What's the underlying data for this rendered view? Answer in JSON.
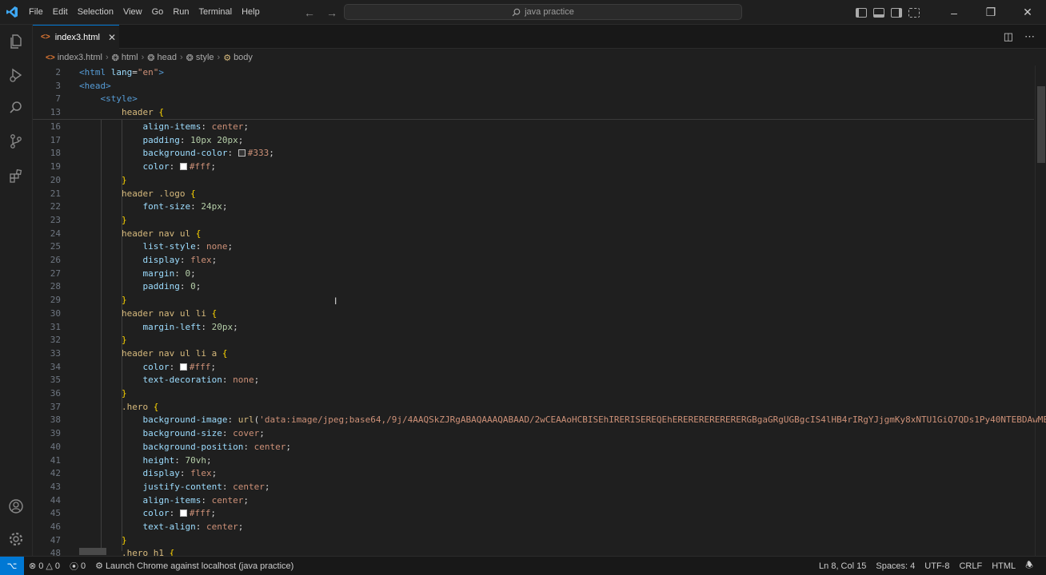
{
  "menu": [
    "File",
    "Edit",
    "Selection",
    "View",
    "Go",
    "Run",
    "Terminal",
    "Help"
  ],
  "search": {
    "text": "java practice"
  },
  "tab": {
    "label": "index3.html"
  },
  "breadcrumbs": [
    "index3.html",
    "html",
    "head",
    "style",
    "body"
  ],
  "sticky_lines": [
    {
      "n": "2",
      "indent": 0,
      "html": "<span class='t-tag'>&lt;html</span> <span class='t-attr'>lang</span>=<span class='t-str'>\"en\"</span><span class='t-tag'>&gt;</span>"
    },
    {
      "n": "3",
      "indent": 0,
      "html": "<span class='t-tag'>&lt;head&gt;</span>"
    },
    {
      "n": "7",
      "indent": 1,
      "html": "<span class='t-tag'>&lt;style&gt;</span>"
    },
    {
      "n": "13",
      "indent": 2,
      "html": "<span class='t-sel'>header</span> <span class='t-brace'>{</span>"
    }
  ],
  "code_lines": [
    {
      "n": "16",
      "indent": 3,
      "html": "<span class='t-prop'>align-items</span>: <span class='t-val'>center</span>;"
    },
    {
      "n": "17",
      "indent": 3,
      "html": "<span class='t-prop'>padding</span>: <span class='t-num'>10px 20px</span>;"
    },
    {
      "n": "18",
      "indent": 3,
      "html": "<span class='t-prop'>background-color</span>: <span class='swatch' style='background:#333'></span><span class='t-val'>#333</span>;"
    },
    {
      "n": "19",
      "indent": 3,
      "html": "<span class='t-prop'>color</span>: <span class='swatch' style='background:#fff'></span><span class='t-val'>#fff</span>;"
    },
    {
      "n": "20",
      "indent": 2,
      "html": "<span class='t-brace'>}</span>"
    },
    {
      "n": "21",
      "indent": 2,
      "html": "<span class='t-sel'>header .logo</span> <span class='t-brace'>{</span>"
    },
    {
      "n": "22",
      "indent": 3,
      "html": "<span class='t-prop'>font-size</span>: <span class='t-num'>24px</span>;"
    },
    {
      "n": "23",
      "indent": 2,
      "html": "<span class='t-brace'>}</span>"
    },
    {
      "n": "24",
      "indent": 2,
      "html": "<span class='t-sel'>header nav ul</span> <span class='t-brace'>{</span>"
    },
    {
      "n": "25",
      "indent": 3,
      "html": "<span class='t-prop'>list-style</span>: <span class='t-val'>none</span>;"
    },
    {
      "n": "26",
      "indent": 3,
      "html": "<span class='t-prop'>display</span>: <span class='t-val'>flex</span>;"
    },
    {
      "n": "27",
      "indent": 3,
      "html": "<span class='t-prop'>margin</span>: <span class='t-num'>0</span>;"
    },
    {
      "n": "28",
      "indent": 3,
      "html": "<span class='t-prop'>padding</span>: <span class='t-num'>0</span>;"
    },
    {
      "n": "29",
      "indent": 2,
      "html": "<span class='t-brace'>}</span>"
    },
    {
      "n": "30",
      "indent": 2,
      "html": "<span class='t-sel'>header nav ul li</span> <span class='t-brace'>{</span>"
    },
    {
      "n": "31",
      "indent": 3,
      "html": "<span class='t-prop'>margin-left</span>: <span class='t-num'>20px</span>;"
    },
    {
      "n": "32",
      "indent": 2,
      "html": "<span class='t-brace'>}</span>"
    },
    {
      "n": "33",
      "indent": 2,
      "html": "<span class='t-sel'>header nav ul li a</span> <span class='t-brace'>{</span>"
    },
    {
      "n": "34",
      "indent": 3,
      "html": "<span class='t-prop'>color</span>: <span class='swatch' style='background:#fff'></span><span class='t-val'>#fff</span>;"
    },
    {
      "n": "35",
      "indent": 3,
      "html": "<span class='t-prop'>text-decoration</span>: <span class='t-val'>none</span>;"
    },
    {
      "n": "36",
      "indent": 2,
      "html": "<span class='t-brace'>}</span>"
    },
    {
      "n": "37",
      "indent": 2,
      "html": "<span class='t-sel'>.hero</span> <span class='t-brace'>{</span>"
    },
    {
      "n": "38",
      "indent": 3,
      "html": "<span class='t-prop'>background-image</span>: <span class='t-sel'>url</span>(<span class='t-str'>'data:image/jpeg;base64,/9j/4AAQSkZJRgABAQAAAQABAAD/2wCEAAoHCBISEhIRERISEREQEhERERERERERERERGBgaGRgUGBgcIS4lHB4rIRgYJjgmKy8xNTU1GiQ7QDs1Py40NTEBDAwMEA</span>"
    },
    {
      "n": "39",
      "indent": 3,
      "html": "<span class='t-prop'>background-size</span>: <span class='t-val'>cover</span>;"
    },
    {
      "n": "40",
      "indent": 3,
      "html": "<span class='t-prop'>background-position</span>: <span class='t-val'>center</span>;"
    },
    {
      "n": "41",
      "indent": 3,
      "html": "<span class='t-prop'>height</span>: <span class='t-num'>70vh</span>;"
    },
    {
      "n": "42",
      "indent": 3,
      "html": "<span class='t-prop'>display</span>: <span class='t-val'>flex</span>;"
    },
    {
      "n": "43",
      "indent": 3,
      "html": "<span class='t-prop'>justify-content</span>: <span class='t-val'>center</span>;"
    },
    {
      "n": "44",
      "indent": 3,
      "html": "<span class='t-prop'>align-items</span>: <span class='t-val'>center</span>;"
    },
    {
      "n": "45",
      "indent": 3,
      "html": "<span class='t-prop'>color</span>: <span class='swatch' style='background:#fff'></span><span class='t-val'>#fff</span>;"
    },
    {
      "n": "46",
      "indent": 3,
      "html": "<span class='t-prop'>text-align</span>: <span class='t-val'>center</span>;"
    },
    {
      "n": "47",
      "indent": 2,
      "html": "<span class='t-brace'>}</span>"
    },
    {
      "n": "48",
      "indent": 2,
      "html": "<span class='t-sel'>.hero h1</span> <span class='t-brace'>{</span>"
    }
  ],
  "status": {
    "errors": "0",
    "warnings": "0",
    "ports": "0",
    "launch": "Launch Chrome against localhost (java practice)",
    "position": "Ln 8, Col 15",
    "spaces": "Spaces: 4",
    "encoding": "UTF-8",
    "eol": "CRLF",
    "language": "HTML"
  },
  "colors": {
    "accent": "#0078d4",
    "background": "#1f1f1f"
  }
}
